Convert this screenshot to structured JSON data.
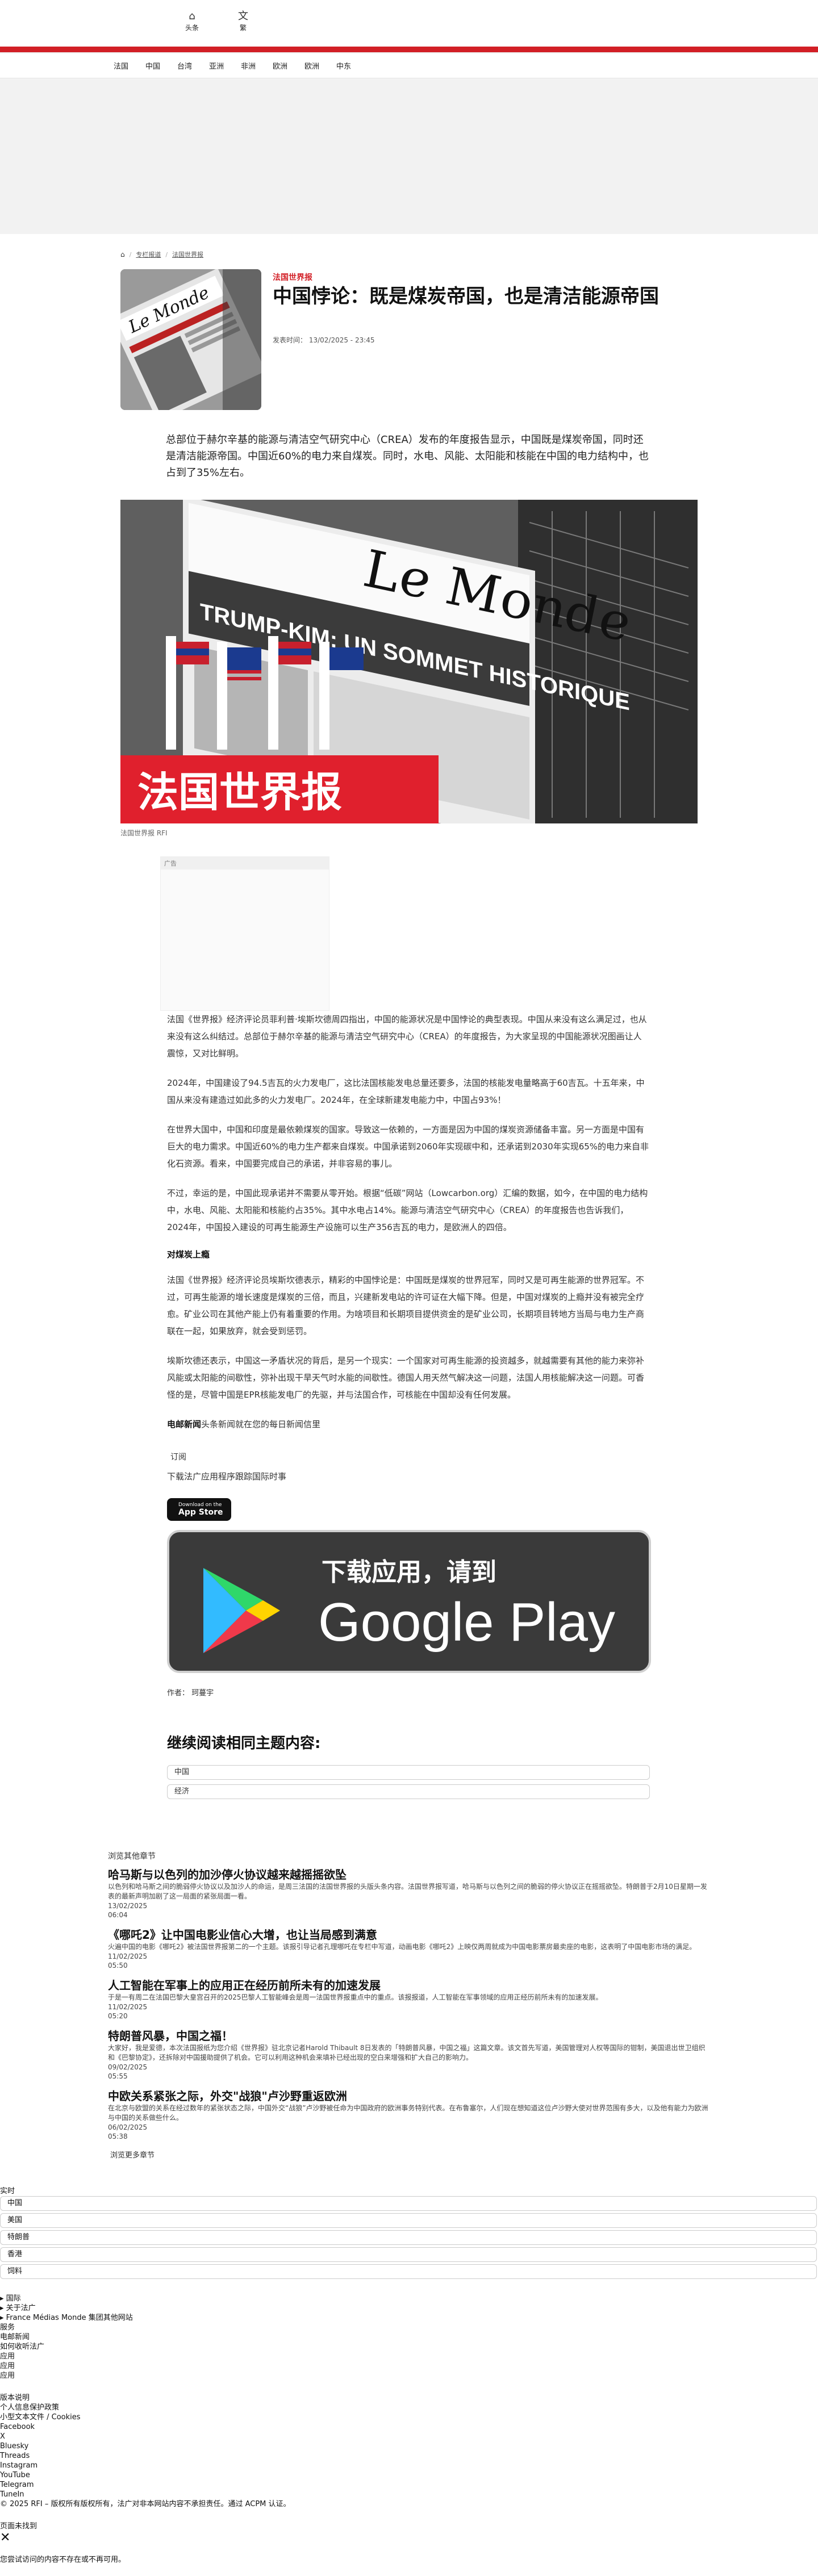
{
  "topbar": {
    "home_label": "头条",
    "lang_label": "繁"
  },
  "nav": [
    "法国",
    "中国",
    "台湾",
    "亚洲",
    "非洲",
    "欧洲",
    "欧洲",
    "中东"
  ],
  "breadcrumb": {
    "items": [
      "专栏报道",
      "法国世界报"
    ]
  },
  "article": {
    "source_label": "法国世界报",
    "title": "中国悖论：既是煤炭帝国，也是清洁能源帝国",
    "published": "发表时间： 13/02/2025 - 23:45",
    "lede": "总部位于赫尔辛基的能源与清洁空气研究中心（CREA）发布的年度报告显示，中国既是煤炭帝国，同时还是清洁能源帝国。中国近60%的电力来自煤炭。同时，水电、风能、太阳能和核能在中国的电力结构中，也占到了35%左右。",
    "hero_caption": "法国世界报 RFI",
    "hero_banner_text": "法国世界报",
    "hero_headline": "TRUMP-KIM: UN SOMMET HISTORIQUE",
    "masthead": "Le Monde",
    "ad_label": "广告",
    "paragraphs": [
      "法国《世界报》经济评论员菲利普·埃斯坎德周四指出，中国的能源状况是中国悖论的典型表现。中国从来没有这么满足过，也从来没有这么纠结过。总部位于赫尔辛基的能源与清洁空气研究中心（CREA）的年度报告，为大家呈现的中国能源状况图画让人震惊，又对比鲜明。",
      "2024年，中国建设了94.5吉瓦的火力发电厂，这比法国核能发电总量还要多，法国的核能发电量略高于60吉瓦。十五年来，中国从来没有建造过如此多的火力发电厂。2024年，在全球新建发电能力中，中国占93%！",
      "在世界大国中，中国和印度是最依赖煤炭的国家。导致这一依赖的，一方面是因为中国的煤炭资源储备丰富。另一方面是中国有巨大的电力需求。中国近60%的电力生产都来自煤炭。中国承诺到2060年实现碳中和，还承诺到2030年实现65%的电力来自非化石资源。看来，中国要完成自己的承诺，并非容易的事儿。",
      "不过，幸运的是，中国此现承诺并不需要从零开始。根据“低碳”网站（Lowcarbon.org）汇编的数据，如今，在中国的电力结构中，水电、风能、太阳能和核能约占35%。其中水电占14%。能源与清洁空气研究中心（CREA）的年度报告也告诉我们，2024年，中国投入建设的可再生能源生产设施可以生产356吉瓦的电力，是欧洲人的四倍。"
    ],
    "section_heading": "对煤炭上瘾",
    "paragraphs2": [
      "法国《世界报》经济评论员埃斯坎德表示，精彩的中国悖论是：中国既是煤炭的世界冠军，同时又是可再生能源的世界冠军。不过，可再生能源的增长速度是煤炭的三倍，而且，兴建新发电站的许可证在大幅下降。但是，中国对煤炭的上瘾并没有被完全疗愈。矿业公司在其他产能上仍有着重要的作用。为啥项目和长期项目提供资金的是矿业公司，长期项目转地方当局与电力生产商联在一起，如果放弃，就会受到惩罚。",
      "埃斯坎德还表示，中国这一矛盾状况的背后，是另一个现实：一个国家对可再生能源的投资越多，就越需要有其他的能力来弥补风能或太阳能的间歇性，弥补出现干旱天气时水能的间歇性。德国人用天然气解决这一问题，法国人用核能解决这一问题。可香怪的是，尽管中国是EPR核能发电厂的先驱，并与法国合作，可核能在中国却没有任何发展。"
    ],
    "newsletter": {
      "bold": "电邮新闻",
      "rest": "头条新闻就在您的每日新闻信里"
    },
    "subscribe_label": "订阅",
    "download_text": "下载法广应用程序跟踪国际时事",
    "appstore_small": "Download on the",
    "appstore_big": "App Store",
    "googleplay_top": "下载应用，请到",
    "googleplay_big": "Google Play",
    "author": "作者： 珂蔓宇"
  },
  "related": {
    "title": "继续阅读相同主题内容:",
    "tags": [
      "中国",
      "经济"
    ]
  },
  "more": {
    "label": "浏览其他章节",
    "items": [
      {
        "title": "哈马斯与以色列的加沙停火协议越来越摇摇欲坠",
        "summary": "以色列和哈马斯之间的脆弱停火协议以及加沙人的命运，是周三法国的法国世界报的头版头条内容。法国世界报写道，哈马斯与以色列之间的脆弱的停火协议正在摇摇欲坠。特朗普于2月10日星期一发表的最新声明加剧了这一局面的紧张局面一看。",
        "date": "13/02/2025",
        "time": "06:04"
      },
      {
        "title": "《哪吒2》让中国电影业信心大增，也让当局感到满意",
        "summary": "火遍中国的电影《哪吒2》被法国世界报第二的一个主题。该报引导记者孔理哪吒在专栏中写道，动画电影《哪吒2》上映仅两周就成为中国电影票房最卖座的电影，这表明了中国电影市场的满足。",
        "date": "11/02/2025",
        "time": "05:50"
      },
      {
        "title": "人工智能在军事上的应用正在经历前所未有的加速发展",
        "summary": "于是一有周二在法国巴黎大皇宫召开的2025巴黎人工智能峰会是周一法国世界报重点中的重点。该报报道，人工智能在军事领域的应用正经历前所未有的加速发展。",
        "date": "11/02/2025",
        "time": "05:20"
      },
      {
        "title": "特朗普风暴，中国之福！",
        "summary": "大家好，我是爱德，本次法国报纸为您介绍《世界报》驻北京记者Harold Thibault 8日发表的「特朗普风暴，中国之福」这篇文章。该文首先写道，美国管理对人权等国际的钳制，美国退出世卫组织和《巴黎协定》，还拆除对中国援助提供了机会。它可以利用这种机会来填补已经出现的空白来增强和扩大自己的影响力。",
        "date": "09/02/2025",
        "time": "05:55"
      },
      {
        "title": "中欧关系紧张之际，外交\"战狼\"卢沙野重返欧洲",
        "summary": "在北京与欧盟的关系在经过数年的紧张状态之际，中国外交“战狼”卢沙野被任命为中国政府的欧洲事务特别代表。在布鲁塞尔，人们现在想知道这位卢沙野大使对世界范围有多大，以及他有能力为欧洲与中国的关系做些什么。",
        "date": "06/02/2025",
        "time": "05:38"
      }
    ],
    "all_label": "浏览更多章节"
  },
  "footer": {
    "live_label": "实时",
    "live_options": [
      "中国",
      "美国",
      "特朗普",
      "香港",
      "饲料"
    ],
    "links1": [
      "▸ 国际",
      "▸ 关于法广",
      "▸ France Médias Monde 集团其他网站"
    ],
    "col_label": "服务",
    "links2": [
      "电邮新闻",
      "如何收听法广",
      "应用",
      "应用",
      "应用"
    ],
    "links3": [
      "版本说明",
      "个人信息保护政策",
      "小型文本文件 / Cookies"
    ],
    "social": [
      "Facebook",
      "X",
      "Bluesky",
      "Threads",
      "Instagram",
      "YouTube",
      "Telegram",
      "TuneIn"
    ],
    "copyright": "© 2025 RFI – 版权所有版权所有，法广对非本网站内容不承担责任。通过 ACPM 认证。",
    "notfound_title": "页面未找到",
    "notfound_text": "您尝试访问的内容不存在或不再可用。"
  },
  "colors": {
    "accent": "#d21f26",
    "text": "#111111"
  }
}
